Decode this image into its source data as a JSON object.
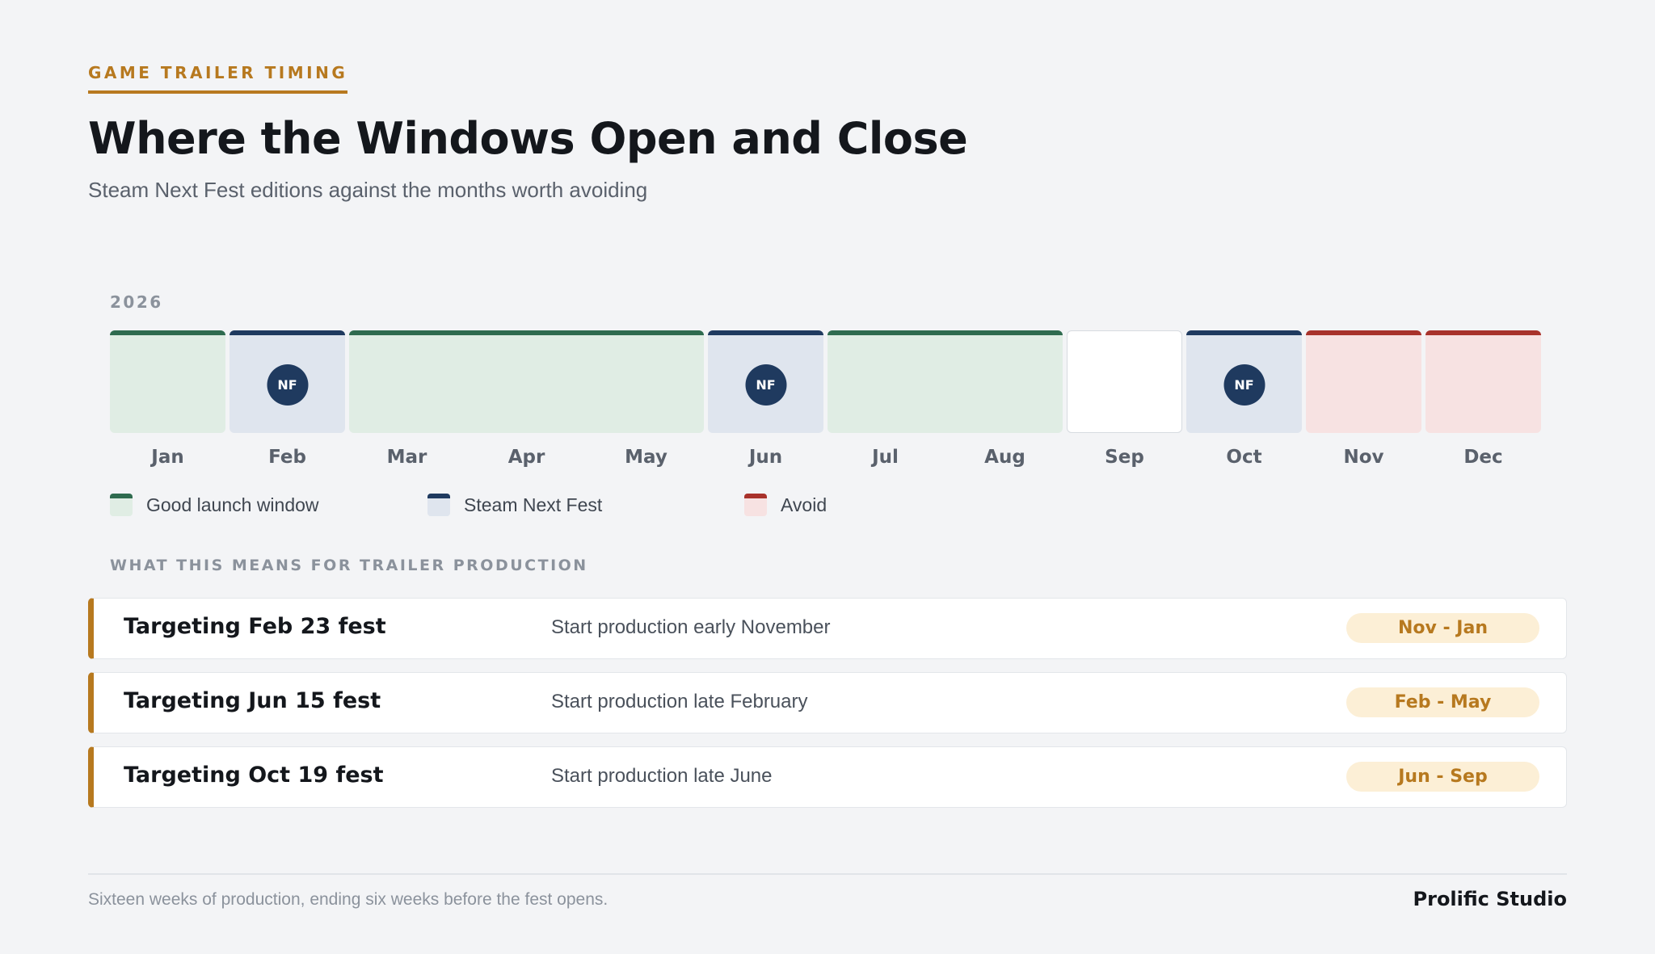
{
  "header": {
    "eyebrow": "GAME TRAILER TIMING",
    "title": "Where the Windows Open and Close",
    "subtitle": "Steam Next Fest editions against the months worth avoiding"
  },
  "calendar": {
    "year": "2026",
    "badge_text": "NF",
    "months": [
      {
        "label": "Jan",
        "status": "good"
      },
      {
        "label": "Feb",
        "status": "fest"
      },
      {
        "label": "Mar",
        "status": "good"
      },
      {
        "label": "Apr",
        "status": "good"
      },
      {
        "label": "May",
        "status": "good"
      },
      {
        "label": "Jun",
        "status": "fest"
      },
      {
        "label": "Jul",
        "status": "good"
      },
      {
        "label": "Aug",
        "status": "good"
      },
      {
        "label": "Sep",
        "status": "neutral"
      },
      {
        "label": "Oct",
        "status": "fest"
      },
      {
        "label": "Nov",
        "status": "avoid"
      },
      {
        "label": "Dec",
        "status": "avoid"
      }
    ],
    "colors": {
      "good": "#2f6b4f",
      "fest": "#1f3a5f",
      "avoid": "#a8322b"
    }
  },
  "legend": [
    {
      "label": "Good launch window",
      "status": "good"
    },
    {
      "label": "Steam Next Fest",
      "status": "fest"
    },
    {
      "label": "Avoid",
      "status": "avoid"
    }
  ],
  "production": {
    "section_label": "WHAT THIS MEANS FOR TRAILER PRODUCTION",
    "rows": [
      {
        "title": "Targeting Feb 23 fest",
        "detail": "Start production early November",
        "window": "Nov - Jan"
      },
      {
        "title": "Targeting Jun 15 fest",
        "detail": "Start production late February",
        "window": "Feb - May"
      },
      {
        "title": "Targeting Oct 19 fest",
        "detail": "Start production late June",
        "window": "Jun - Sep"
      }
    ]
  },
  "footer": {
    "note": "Sixteen weeks of production, ending six weeks before the fest opens.",
    "brand": "Prolific Studio"
  }
}
